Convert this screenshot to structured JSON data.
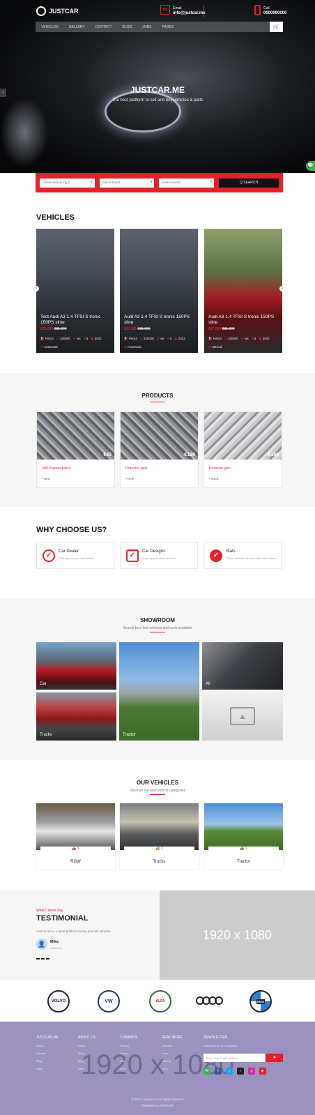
{
  "header": {
    "logo": "JUSTCAR",
    "email_label": "Email",
    "email": "info@justcar.me",
    "phone_label": "Call",
    "phone": "0000000000",
    "nav": [
      "Vehicles",
      "Gallery",
      "Contact",
      "Blog",
      "Jobs",
      "Pages"
    ],
    "cart_icon": "cart-icon"
  },
  "hero": {
    "title": "JUSTCAR.ME",
    "subtitle": "The best platform to sell and buy vehicles & parts"
  },
  "search": {
    "type_placeholder": "Select Vehicle Type",
    "brand_placeholder": "Select Brand",
    "model_placeholder": "Select Model",
    "button": "Q SEARCH"
  },
  "vehicles": {
    "heading": "VEHICLES",
    "items": [
      {
        "title": "Test Audi A3 1.4 TFSI S tronic 150PS sline",
        "price": "€25.000",
        "old": "€35.000",
        "specs": [
          "Petrol",
          "320000",
          "ws",
          "8",
          "2022"
        ],
        "gear": "Automatic"
      },
      {
        "title": "Audi A3 1.4 TFSI S tronic 150PS sline",
        "price": "€17.000",
        "old": "€35.000",
        "specs": [
          "Petrol",
          "320000",
          "ws",
          "8",
          "2022"
        ],
        "gear": "Automatic"
      },
      {
        "title": "Audi A3 1.4 TFSI S tronic 150PS sline",
        "price": "€17.000",
        "old": "€35.000",
        "specs": [
          "Petrol",
          "320000",
          "ws",
          "8",
          "2022"
        ],
        "gear": "Manual"
      }
    ]
  },
  "products": {
    "heading": "PRODUCTS",
    "items": [
      {
        "name": "VW Passat parts",
        "price": "€45",
        "cond": "New"
      },
      {
        "name": "Porsche gen",
        "price": "€199",
        "cond": "New"
      },
      {
        "name": "Porsche gen",
        "price": "€199",
        "cond": "Used"
      }
    ]
  },
  "why": {
    "heading": "WHY CHOOSE US?",
    "items": [
      {
        "title": "Car Dealer",
        "desc": "Find any car you need easily"
      },
      {
        "title": "Car Designs",
        "desc": "Lorem ipsum dolor sit amet"
      },
      {
        "title": "Stats",
        "desc": "Check statistics of your sales and visitors"
      }
    ]
  },
  "showroom": {
    "heading": "SHOWROOM",
    "subtitle": "Search best find vehicles and parts available",
    "tiles": [
      "Car",
      "Tractor",
      "All",
      "Trucks",
      ""
    ]
  },
  "our_vehicles": {
    "heading": "OUR VEHICLES",
    "subtitle": "Discover our best vehicle categories",
    "items": [
      {
        "name": "RGW",
        "count": "1"
      },
      {
        "name": "Trucks",
        "count": "1"
      },
      {
        "name": "Tractor",
        "count": "1"
      }
    ]
  },
  "testimonial": {
    "kicker": "What Clients Say",
    "heading": "TESTIMONIAL",
    "quote": "Justcar.me is a great platform to buy and sell vehicles",
    "author": "Mike",
    "role": "Customer",
    "placeholder": "1920 x 1080"
  },
  "brands": [
    "VOLVO",
    "VW",
    "ALFA",
    "AUDI",
    "BMW"
  ],
  "footer": {
    "cols": [
      {
        "title": "JUSTCAR.ME",
        "links": [
          "About",
          "Contact",
          "Blog",
          "Jobs"
        ]
      },
      {
        "title": "ABOUT US",
        "links": [
          "About",
          "Team",
          "Blog",
          "Jobs"
        ]
      },
      {
        "title": "COMPANY",
        "links": [
          "Privacy",
          "Terms",
          "Help",
          "Jobs"
        ]
      },
      {
        "title": "READ MORE",
        "links": [
          "Vehicles",
          "Parts",
          "Gallery",
          "Jobs"
        ]
      }
    ],
    "newsletter_title": "NEWSLETTER",
    "newsletter_text": "Subscribe to our newsletter",
    "newsletter_placeholder": "Enter Your Email Address",
    "watermark": "1920 x 1080",
    "copyright": "© 2022 Justcar.me All rights reserved",
    "credit": "Powered by JUSTCAR"
  }
}
